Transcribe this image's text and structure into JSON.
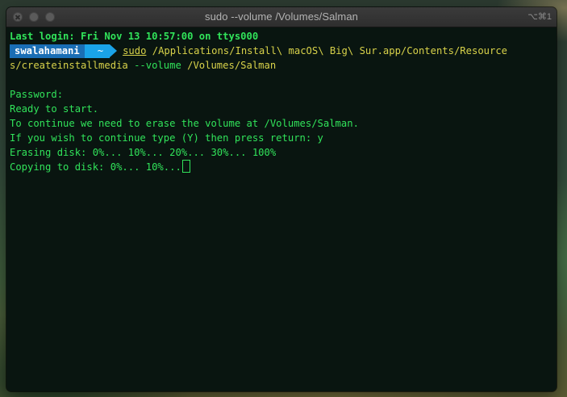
{
  "window": {
    "title": "sudo  --volume /Volumes/Salman",
    "shortcut": "⌥⌘1"
  },
  "terminal": {
    "last_login": "Last login: Fri Nov 13 10:57:00 on ttys000",
    "prompt_user": "swalahamani",
    "prompt_dir": "~",
    "command_sudo": "sudo",
    "command_rest": " /Applications/Install\\ macOS\\ Big\\ Sur.app/Contents/Resource",
    "command_wrap": "s/createinstallmedia",
    "command_flag": " --volume ",
    "command_volume": "/Volumes/Salman",
    "output": [
      "",
      "Password:",
      "Ready to start.",
      "To continue we need to erase the volume at /Volumes/Salman.",
      "If you wish to continue type (Y) then press return: y",
      "Erasing disk: 0%... 10%... 20%... 30%... 100%",
      "Copying to disk: 0%... 10%..."
    ]
  },
  "colors": {
    "terminal_text": "#31e35a",
    "command_text": "#d8d24a",
    "prompt_user_bg": "#1a6eb5",
    "prompt_dir_bg": "#1aa3e8"
  }
}
